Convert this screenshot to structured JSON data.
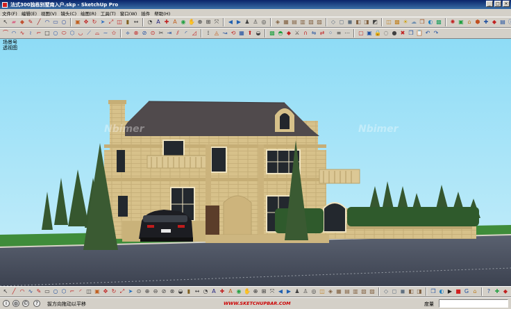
{
  "window": {
    "title": "法式300独栋别墅南入户.skp - SketchUp Pro",
    "controls": {
      "minimize": "_",
      "maximize": "□",
      "close": "×"
    }
  },
  "menu": [
    "文件(F)",
    "编辑(E)",
    "视图(V)",
    "镜头(C)",
    "绘图(R)",
    "工具(T)",
    "窗口(W)",
    "插件",
    "帮助(H)"
  ],
  "toolbars": {
    "row1": [
      {
        "icon": "select-icon",
        "glyph": "↖",
        "color": "#333333"
      },
      {
        "icon": "eraser-icon",
        "glyph": "▰",
        "color": "#d86a8a"
      },
      {
        "icon": "paint-icon",
        "glyph": "◆",
        "color": "#c05030"
      },
      {
        "icon": "pencil-icon",
        "glyph": "✎",
        "color": "#c02020"
      },
      {
        "icon": "line-icon",
        "glyph": "╱",
        "color": "#a02020"
      },
      {
        "icon": "arc-icon",
        "glyph": "◠",
        "color": "#3050a0"
      },
      {
        "icon": "rectangle-icon",
        "glyph": "▭",
        "color": "#3050a0"
      },
      {
        "icon": "circle-icon",
        "glyph": "○",
        "color": "#3050a0"
      },
      {
        "sep": true
      },
      {
        "icon": "push-pull-icon",
        "glyph": "▣",
        "color": "#c06020"
      },
      {
        "icon": "move-icon",
        "glyph": "✥",
        "color": "#c02020"
      },
      {
        "icon": "rotate-icon",
        "glyph": "↻",
        "color": "#c02020"
      },
      {
        "icon": "follow-me-icon",
        "glyph": "➤",
        "color": "#3070c0"
      },
      {
        "icon": "scale-icon",
        "glyph": "⤢",
        "color": "#c02020"
      },
      {
        "icon": "offset-icon",
        "glyph": "◫",
        "color": "#c02020"
      },
      {
        "icon": "tape-icon",
        "glyph": "▮",
        "color": "#806020"
      },
      {
        "icon": "dimension-icon",
        "glyph": "↔",
        "color": "#404040"
      },
      {
        "sep": true
      },
      {
        "icon": "protractor-icon",
        "glyph": "◔",
        "color": "#404040"
      },
      {
        "icon": "text-icon",
        "glyph": "A",
        "color": "#202080"
      },
      {
        "icon": "axes-icon",
        "glyph": "✚",
        "color": "#c02020"
      },
      {
        "icon": "3d-text-icon",
        "glyph": "A",
        "color": "#c06020"
      },
      {
        "icon": "orbit-icon",
        "glyph": "◉",
        "color": "#20a040"
      },
      {
        "icon": "pan-icon",
        "glyph": "✋",
        "color": "#806040"
      },
      {
        "icon": "zoom-icon",
        "glyph": "⊕",
        "color": "#303030"
      },
      {
        "icon": "zoom-window-icon",
        "glyph": "⊞",
        "color": "#303030"
      },
      {
        "icon": "zoom-extents-icon",
        "glyph": "⤧",
        "color": "#303030"
      },
      {
        "sep": true
      },
      {
        "icon": "previous-view-icon",
        "glyph": "◀",
        "color": "#2060b0"
      },
      {
        "icon": "next-view-icon",
        "glyph": "▶",
        "color": "#2060b0"
      },
      {
        "icon": "position-camera-icon",
        "glyph": "♟",
        "color": "#404040"
      },
      {
        "icon": "walk-icon",
        "glyph": "♙",
        "color": "#404040"
      },
      {
        "icon": "look-around-icon",
        "glyph": "◎",
        "color": "#404040"
      },
      {
        "sep": true
      },
      {
        "icon": "iso-view-icon",
        "glyph": "◈",
        "color": "#806040"
      },
      {
        "icon": "top-view-icon",
        "glyph": "▦",
        "color": "#806040"
      },
      {
        "icon": "front-view-icon",
        "glyph": "▤",
        "color": "#806040"
      },
      {
        "icon": "right-view-icon",
        "glyph": "▥",
        "color": "#806040"
      },
      {
        "icon": "back-view-icon",
        "glyph": "▧",
        "color": "#806040"
      },
      {
        "icon": "left-view-icon",
        "glyph": "▨",
        "color": "#806040"
      },
      {
        "sep": true
      },
      {
        "icon": "xray-icon",
        "glyph": "◇",
        "color": "#607080"
      },
      {
        "icon": "wireframe-icon",
        "glyph": "◻",
        "color": "#607080"
      },
      {
        "icon": "hidden-line-icon",
        "glyph": "◼",
        "color": "#607080"
      },
      {
        "icon": "shaded-icon",
        "glyph": "◧",
        "color": "#806040"
      },
      {
        "icon": "textured-icon",
        "glyph": "◨",
        "color": "#806040"
      },
      {
        "icon": "monochrome-icon",
        "glyph": "◩",
        "color": "#404040"
      },
      {
        "sep": true
      },
      {
        "icon": "section-plane-icon",
        "glyph": "◫",
        "color": "#c08020"
      },
      {
        "icon": "section-cut-icon",
        "glyph": "▩",
        "color": "#c08020"
      },
      {
        "icon": "shadow-icon",
        "glyph": "☀",
        "color": "#d0a000"
      },
      {
        "icon": "fog-icon",
        "glyph": "☁",
        "color": "#7090b0"
      },
      {
        "icon": "components-icon",
        "glyph": "❒",
        "color": "#a05020"
      },
      {
        "icon": "materials-icon",
        "glyph": "◐",
        "color": "#2080c0"
      },
      {
        "icon": "styles-icon",
        "glyph": "▩",
        "color": "#20a060"
      },
      {
        "sep": true
      },
      {
        "icon": "geo-icon",
        "glyph": "✺",
        "color": "#c02020"
      },
      {
        "icon": "photo-texture-icon",
        "glyph": "▣",
        "color": "#20a040"
      },
      {
        "icon": "warehouse-icon",
        "glyph": "⌂",
        "color": "#c08020"
      },
      {
        "icon": "share-icon",
        "glyph": "⬢",
        "color": "#c05020"
      },
      {
        "icon": "extension-icon",
        "glyph": "✚",
        "color": "#2050a0"
      },
      {
        "icon": "ruby-icon",
        "glyph": "◆",
        "color": "#c02020"
      },
      {
        "icon": "layers-icon",
        "glyph": "▤",
        "color": "#2050a0"
      },
      {
        "icon": "entity-info-icon",
        "glyph": "ⓘ",
        "color": "#2050a0"
      },
      {
        "icon": "outliner-icon",
        "glyph": "☰",
        "color": "#404040"
      },
      {
        "icon": "scenes-icon",
        "glyph": "▶",
        "color": "#20a040"
      },
      {
        "icon": "sandbox-icon",
        "glyph": "◭",
        "color": "#806040"
      },
      {
        "icon": "smoove-icon",
        "glyph": "◬",
        "color": "#806040"
      },
      {
        "icon": "stamp-icon",
        "glyph": "◪",
        "color": "#806040"
      },
      {
        "icon": "drape-icon",
        "glyph": "◮",
        "color": "#806040"
      },
      {
        "icon": "color-wheel-icon",
        "glyph": "◕",
        "color": "#2080c0"
      },
      {
        "icon": "texture-tool-icon",
        "glyph": "▤",
        "color": "#20a040"
      },
      {
        "icon": "render-icon",
        "glyph": "◉",
        "color": "#c06020"
      },
      {
        "icon": "plugin-icon",
        "glyph": "■",
        "color": "#c02020"
      }
    ],
    "row2": [
      {
        "icon": "shape-curve-icon",
        "glyph": "⌒",
        "color": "#c02020"
      },
      {
        "icon": "shape-arc-icon",
        "glyph": "◠",
        "color": "#3060b0"
      },
      {
        "icon": "shape-spline-icon",
        "glyph": "∿",
        "color": "#c02020"
      },
      {
        "icon": "shape-zigzag-icon",
        "glyph": "≀",
        "color": "#3060b0"
      },
      {
        "icon": "shape-corner-icon",
        "glyph": "⌐",
        "color": "#c02020"
      },
      {
        "icon": "shape-square-icon",
        "glyph": "□",
        "color": "#303030"
      },
      {
        "icon": "shape-circle-icon",
        "glyph": "○",
        "color": "#3060b0"
      },
      {
        "icon": "shape-ellipse-icon",
        "glyph": "⬭",
        "color": "#c02020"
      },
      {
        "icon": "shape-hexagon-icon",
        "glyph": "⬡",
        "color": "#3060b0"
      },
      {
        "icon": "shape-arc-3-icon",
        "glyph": "◡",
        "color": "#c02020"
      },
      {
        "icon": "shape-polyline-icon",
        "glyph": "⟋",
        "color": "#3060b0"
      },
      {
        "icon": "shape-fillet-icon",
        "glyph": "⌓",
        "color": "#c02020"
      },
      {
        "icon": "shape-wave-icon",
        "glyph": "∼",
        "color": "#3060b0"
      },
      {
        "icon": "shape-star-icon",
        "glyph": "✩",
        "color": "#c02020"
      },
      {
        "sep": true
      },
      {
        "icon": "weld-icon",
        "glyph": "⟡",
        "color": "#2050a0"
      },
      {
        "icon": "join-icon",
        "glyph": "⊗",
        "color": "#c02020"
      },
      {
        "icon": "divide-icon",
        "glyph": "⊘",
        "color": "#2050a0"
      },
      {
        "icon": "intersect-icon",
        "glyph": "⊙",
        "color": "#c02020"
      },
      {
        "icon": "trim-icon",
        "glyph": "✂",
        "color": "#404040"
      },
      {
        "icon": "extend-icon",
        "glyph": "⇥",
        "color": "#2050a0"
      },
      {
        "icon": "split-icon",
        "glyph": "⫽",
        "color": "#c02020"
      },
      {
        "icon": "fillet-icon",
        "glyph": "◜",
        "color": "#2050a0"
      },
      {
        "icon": "chamfer-icon",
        "glyph": "◿",
        "color": "#c02020"
      },
      {
        "sep": true
      },
      {
        "icon": "rail-icon",
        "glyph": "⟟",
        "color": "#404040"
      },
      {
        "icon": "loft-icon",
        "glyph": "◬",
        "color": "#c06020"
      },
      {
        "icon": "sweep-icon",
        "glyph": "↝",
        "color": "#2050a0"
      },
      {
        "icon": "lathe-icon",
        "glyph": "⟲",
        "color": "#c02020"
      },
      {
        "icon": "skin-icon",
        "glyph": "▦",
        "color": "#2050a0"
      },
      {
        "icon": "extrude-icon",
        "glyph": "⬆",
        "color": "#c02020"
      },
      {
        "icon": "shell-icon",
        "glyph": "◒",
        "color": "#404040"
      },
      {
        "sep": true
      },
      {
        "icon": "subdivide-icon",
        "glyph": "▩",
        "color": "#20a040"
      },
      {
        "icon": "smooth-icon",
        "glyph": "◓",
        "color": "#20a040"
      },
      {
        "icon": "crease-icon",
        "glyph": "◆",
        "color": "#c02020"
      },
      {
        "icon": "knife-icon",
        "glyph": "⚔",
        "color": "#404040"
      },
      {
        "icon": "magnet-icon",
        "glyph": "∩",
        "color": "#c02020"
      },
      {
        "icon": "flip-icon",
        "glyph": "⇋",
        "color": "#2050a0"
      },
      {
        "icon": "mirror-icon",
        "glyph": "⇄",
        "color": "#c02020"
      },
      {
        "icon": "array-icon",
        "glyph": "⁘",
        "color": "#2050a0"
      },
      {
        "icon": "align-icon",
        "glyph": "≡",
        "color": "#404040"
      },
      {
        "icon": "distribute-icon",
        "glyph": "⋯",
        "color": "#404040"
      },
      {
        "sep": true
      },
      {
        "icon": "group-icon",
        "glyph": "▢",
        "color": "#c02020"
      },
      {
        "icon": "ungroup-icon",
        "glyph": "▣",
        "color": "#2050a0"
      },
      {
        "icon": "lock-icon",
        "glyph": "🔒",
        "color": "#806020"
      },
      {
        "icon": "hide-icon",
        "glyph": "◌",
        "color": "#404040"
      },
      {
        "icon": "unhide-icon",
        "glyph": "●",
        "color": "#404040"
      },
      {
        "icon": "delete-icon",
        "glyph": "✖",
        "color": "#c02020"
      },
      {
        "icon": "copy-icon",
        "glyph": "❐",
        "color": "#2050a0"
      },
      {
        "icon": "paste-icon",
        "glyph": "📋",
        "color": "#806020"
      },
      {
        "icon": "undo-icon",
        "glyph": "↶",
        "color": "#2050a0"
      },
      {
        "icon": "redo-icon",
        "glyph": "↷",
        "color": "#2050a0"
      }
    ],
    "bottom": [
      {
        "icon": "b-select-icon",
        "glyph": "↖",
        "color": "#333333"
      },
      {
        "icon": "b-line-icon",
        "glyph": "╱",
        "color": "#c02020"
      },
      {
        "icon": "b-arc-icon",
        "glyph": "◠",
        "color": "#c02020"
      },
      {
        "icon": "b-curve-icon",
        "glyph": "∿",
        "color": "#2050a0"
      },
      {
        "icon": "b-freehand-icon",
        "glyph": "✎",
        "color": "#c02020"
      },
      {
        "icon": "b-rect-icon",
        "glyph": "▭",
        "color": "#404040"
      },
      {
        "icon": "b-circle-icon",
        "glyph": "○",
        "color": "#2050a0"
      },
      {
        "icon": "b-polygon-icon",
        "glyph": "⬡",
        "color": "#2050a0"
      },
      {
        "icon": "b-corner-icon",
        "glyph": "⌐",
        "color": "#c02020"
      },
      {
        "icon": "b-fillet-icon",
        "glyph": "◜",
        "color": "#c02020"
      },
      {
        "icon": "b-offset-icon",
        "glyph": "◫",
        "color": "#404040"
      },
      {
        "icon": "b-pushpull-icon",
        "glyph": "▣",
        "color": "#c06020"
      },
      {
        "icon": "b-move-icon",
        "glyph": "✥",
        "color": "#c02020"
      },
      {
        "icon": "b-rotate-icon",
        "glyph": "↻",
        "color": "#c02020"
      },
      {
        "icon": "b-scale-icon",
        "glyph": "⤢",
        "color": "#c02020"
      },
      {
        "icon": "b-followme-icon",
        "glyph": "➤",
        "color": "#2070c0"
      },
      {
        "icon": "b-intersect-icon",
        "glyph": "⊙",
        "color": "#404040"
      },
      {
        "icon": "b-solid-union-icon",
        "glyph": "⊕",
        "color": "#404040"
      },
      {
        "icon": "b-solid-subtract-icon",
        "glyph": "⊖",
        "color": "#404040"
      },
      {
        "icon": "b-solid-trim-icon",
        "glyph": "⊘",
        "color": "#404040"
      },
      {
        "icon": "b-solid-split-icon",
        "glyph": "⊗",
        "color": "#404040"
      },
      {
        "icon": "b-shell-icon",
        "glyph": "◒",
        "color": "#404040"
      },
      {
        "icon": "b-tape-icon",
        "glyph": "▮",
        "color": "#806020"
      },
      {
        "icon": "b-dim-icon",
        "glyph": "↔",
        "color": "#404040"
      },
      {
        "icon": "b-protractor-icon",
        "glyph": "◔",
        "color": "#404040"
      },
      {
        "icon": "b-text-icon",
        "glyph": "A",
        "color": "#202080"
      },
      {
        "icon": "b-axes-icon",
        "glyph": "✚",
        "color": "#c02020"
      },
      {
        "icon": "b-3dtext-icon",
        "glyph": "A",
        "color": "#c06020"
      },
      {
        "icon": "b-orbit-icon",
        "glyph": "◉",
        "color": "#20a040"
      },
      {
        "icon": "b-pan-icon",
        "glyph": "✋",
        "color": "#806040"
      },
      {
        "icon": "b-zoom-icon",
        "glyph": "⊕",
        "color": "#303030"
      },
      {
        "icon": "b-zoomwin-icon",
        "glyph": "⊞",
        "color": "#303030"
      },
      {
        "icon": "b-zoomext-icon",
        "glyph": "⤧",
        "color": "#303030"
      },
      {
        "icon": "b-prev-icon",
        "glyph": "◀",
        "color": "#2060b0"
      },
      {
        "icon": "b-next-icon",
        "glyph": "▶",
        "color": "#2060b0"
      },
      {
        "icon": "b-camera-icon",
        "glyph": "♟",
        "color": "#404040"
      },
      {
        "icon": "b-walk-icon",
        "glyph": "♙",
        "color": "#404040"
      },
      {
        "icon": "b-look-icon",
        "glyph": "◎",
        "color": "#404040"
      },
      {
        "icon": "b-section-icon",
        "glyph": "◫",
        "color": "#c08020"
      },
      {
        "icon": "b-iso-icon",
        "glyph": "◈",
        "color": "#806040"
      },
      {
        "icon": "b-top-icon",
        "glyph": "▦",
        "color": "#806040"
      },
      {
        "icon": "b-front-icon",
        "glyph": "▤",
        "color": "#806040"
      },
      {
        "icon": "b-right-icon",
        "glyph": "▥",
        "color": "#806040"
      },
      {
        "icon": "b-back-icon",
        "glyph": "▧",
        "color": "#806040"
      },
      {
        "icon": "b-left-icon",
        "glyph": "▨",
        "color": "#806040"
      },
      {
        "sep": true
      },
      {
        "icon": "b-xray-icon",
        "glyph": "◇",
        "color": "#607080"
      },
      {
        "icon": "b-wire-icon",
        "glyph": "◻",
        "color": "#607080"
      },
      {
        "icon": "b-hidden-icon",
        "glyph": "◼",
        "color": "#607080"
      },
      {
        "icon": "b-shaded-icon",
        "glyph": "◧",
        "color": "#806040"
      },
      {
        "icon": "b-textured-icon",
        "glyph": "◨",
        "color": "#806040"
      },
      {
        "sep": true
      },
      {
        "icon": "b-components-icon",
        "glyph": "❒",
        "color": "#2050a0"
      },
      {
        "icon": "b-materials-icon",
        "glyph": "◐",
        "color": "#2080c0"
      },
      {
        "icon": "b-play-icon",
        "glyph": "▶",
        "color": "#202020"
      },
      {
        "icon": "b-stop-icon",
        "glyph": "■",
        "color": "#d02020"
      },
      {
        "icon": "b-google-icon",
        "glyph": "G",
        "color": "#2050a0"
      },
      {
        "icon": "b-get-models-icon",
        "glyph": "⌂",
        "color": "#c08020"
      },
      {
        "sep": true
      },
      {
        "icon": "b-help-icon",
        "glyph": "?",
        "color": "#2050a0"
      },
      {
        "icon": "b-extension-icon",
        "glyph": "✚",
        "color": "#20a040"
      },
      {
        "icon": "b-plugin-icon",
        "glyph": "◆",
        "color": "#c02020"
      }
    ]
  },
  "viewport": {
    "scene_label": "场景号",
    "view_label": "透视图",
    "watermarks": [
      "Nbimer",
      "Nbimer"
    ],
    "colors": {
      "sky": "#8fdaf4",
      "grass": "#3f8c3a",
      "road": "#4b5563",
      "facade": "#d7c18a",
      "roof": "#504a4c",
      "tree": "#3a5a32"
    }
  },
  "statusbar": {
    "icons": [
      {
        "icon": "status-info-icon",
        "glyph": "i"
      },
      {
        "icon": "status-geo-icon",
        "glyph": "◍"
      },
      {
        "icon": "status-credits-icon",
        "glyph": "©"
      },
      {
        "icon": "status-help-icon",
        "glyph": "?"
      }
    ],
    "message": "拔方向拖动以平移",
    "site_banner": "WWW.SKETCHUPBAR.COM",
    "measure_label": "度量",
    "measure_value": ""
  }
}
